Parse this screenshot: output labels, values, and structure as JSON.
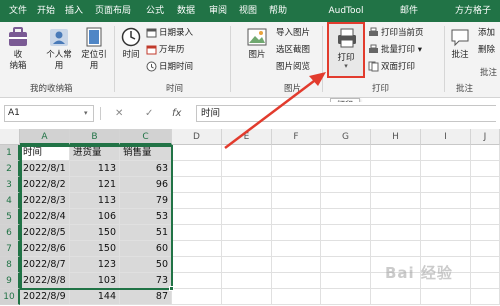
{
  "tabs": [
    "文件",
    "开始",
    "插入",
    "页面布局",
    "公式",
    "数据",
    "审阅",
    "视图",
    "帮助",
    "AudTool",
    "邮件",
    "方方格子"
  ],
  "ribbon": {
    "collect_label": "收\n纳箱",
    "personal_label": "个人常\n用",
    "locate_label": "定位引\n用",
    "my_box_group": "我的收纳箱",
    "time_label": "时间",
    "date_entry": "日期录入",
    "calendar": "万年历",
    "datetime": "日期时间",
    "time_group": "时间",
    "picture_label": "图片",
    "import_picture": "导入图片",
    "area_screenshot": "选区截图",
    "picture_view": "图片阅览",
    "picture_group": "图片",
    "print_label": "打印",
    "print_current": "打印当前页",
    "batch_print": "批量打印",
    "duplex_print": "双面打印",
    "print_group": "打印",
    "comment_label": "批注",
    "comment_group": "批注",
    "add_label": "添加",
    "delete_label": "删除",
    "comment_right": "批注"
  },
  "tooltip": "打印",
  "formula_bar": {
    "name_box": "A1",
    "cancel": "✕",
    "confirm": "✓",
    "fx": "fx",
    "value": "时间"
  },
  "columns": [
    "A",
    "B",
    "C",
    "D",
    "E",
    "F",
    "G",
    "H",
    "I",
    "J"
  ],
  "rows": [
    "1",
    "2",
    "3",
    "4",
    "5",
    "6",
    "7",
    "8",
    "9",
    "10"
  ],
  "table": {
    "headers": [
      "时间",
      "进货量",
      "销售量"
    ],
    "data": [
      [
        "2022/8/1",
        "113",
        "63"
      ],
      [
        "2022/8/2",
        "121",
        "96"
      ],
      [
        "2022/8/3",
        "113",
        "79"
      ],
      [
        "2022/8/4",
        "106",
        "53"
      ],
      [
        "2022/8/5",
        "150",
        "51"
      ],
      [
        "2022/8/6",
        "150",
        "60"
      ],
      [
        "2022/8/7",
        "123",
        "50"
      ],
      [
        "2022/8/8",
        "103",
        "73"
      ],
      [
        "2022/8/9",
        "144",
        "87"
      ]
    ]
  },
  "watermark": "Bai 经验",
  "colors": {
    "excel_green": "#217346",
    "highlight_red": "#e23b2d",
    "selection_gray": "#d9d9d9"
  }
}
